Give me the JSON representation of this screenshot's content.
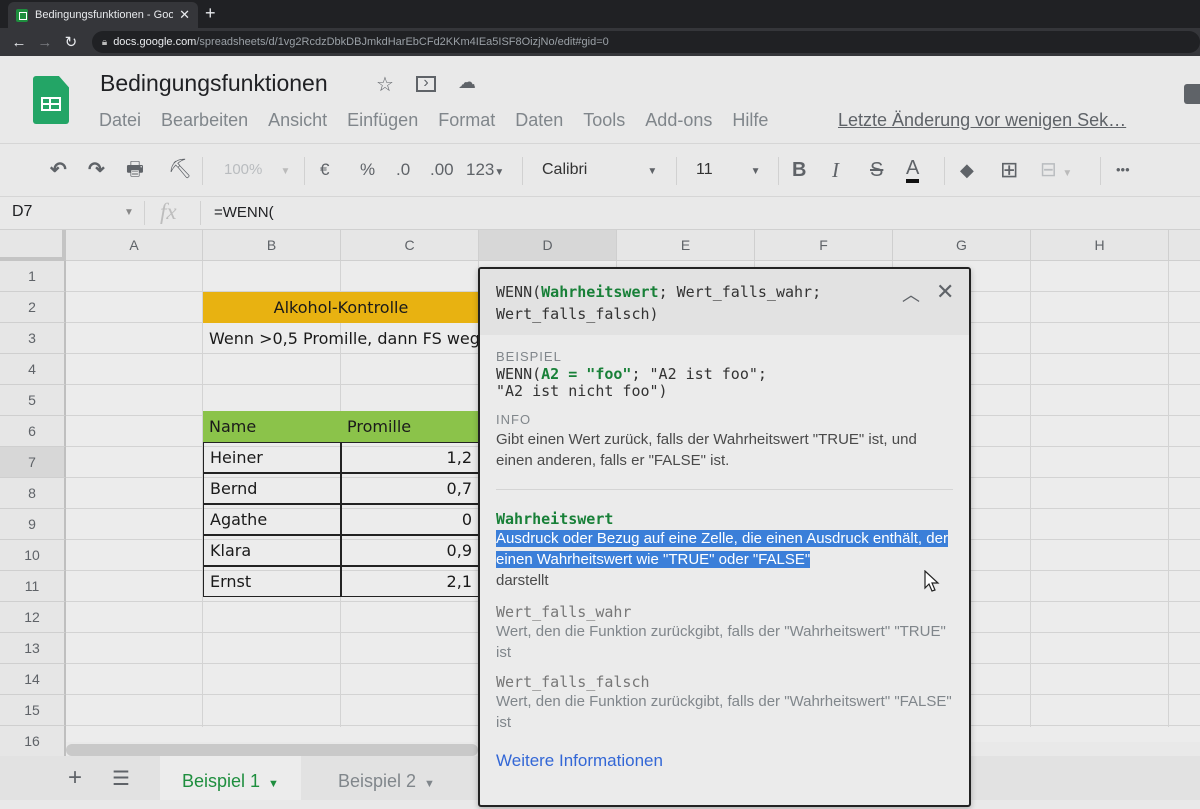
{
  "browser": {
    "tab_title": "Bedingungsfunktionen - Google",
    "url_host": "docs.google.com",
    "url_path": "/spreadsheets/d/1vg2RcdzDbkDBJmkdHarEbCFd2KKm4IEa5ISF8OizjNo/edit#gid=0"
  },
  "header": {
    "title": "Bedingungsfunktionen",
    "menu": [
      "Datei",
      "Bearbeiten",
      "Ansicht",
      "Einfügen",
      "Format",
      "Daten",
      "Tools",
      "Add-ons",
      "Hilfe"
    ],
    "last_edit": "Letzte Änderung vor wenigen Sek…"
  },
  "toolbar": {
    "zoom": "100%",
    "currency": "€",
    "percent": "%",
    "decimal_decrease": ".0",
    "decimal_increase": ".00",
    "number_format": "123",
    "font": "Calibri",
    "font_size": "11",
    "bold": "B",
    "italic": "I",
    "strike": "S",
    "text_color": "A",
    "more": "•••"
  },
  "formula_bar": {
    "cell_ref": "D7",
    "fx": "fx",
    "formula": "=WENN("
  },
  "grid": {
    "columns": [
      "A",
      "B",
      "C",
      "D",
      "E",
      "F",
      "G",
      "H"
    ],
    "selected_column": "D",
    "rows": [
      "1",
      "2",
      "3",
      "4",
      "5",
      "6",
      "7",
      "8",
      "9",
      "10",
      "11",
      "12",
      "13",
      "14",
      "15",
      "16"
    ],
    "selected_row": "7",
    "title_cell": "Alkohol-Kontrolle",
    "note_cell": "Wenn >0,5 Promille, dann FS weg",
    "table_headers": [
      "Name",
      "Promille"
    ],
    "table_rows": [
      {
        "name": "Heiner",
        "promille": "1,2"
      },
      {
        "name": "Bernd",
        "promille": "0,7"
      },
      {
        "name": "Agathe",
        "promille": "0"
      },
      {
        "name": "Klara",
        "promille": "0,9"
      },
      {
        "name": "Ernst",
        "promille": "2,1"
      }
    ],
    "colors": {
      "title_bg": "#e8b211",
      "header_bg": "#8bc34a"
    }
  },
  "sheets": {
    "tabs": [
      {
        "label": "Beispiel 1",
        "active": true
      },
      {
        "label": "Beispiel 2",
        "active": false
      }
    ]
  },
  "help_popup": {
    "signature_fn": "WENN(",
    "signature_arg1": "Wahrheitswert",
    "signature_rest1": "; Wert_falls_wahr;",
    "signature_rest2": "Wert_falls_falsch)",
    "example_label": "BEISPIEL",
    "example_fn": "WENN(",
    "example_cond": "A2 = \"foo\"",
    "example_rest1": "; \"A2 ist foo\";",
    "example_rest2": "\"A2 ist nicht foo\")",
    "info_label": "INFO",
    "info_text": "Gibt einen Wert zurück, falls der Wahrheitswert \"TRUE\" ist, und einen anderen, falls er \"FALSE\" ist.",
    "args": [
      {
        "name": "Wahrheitswert",
        "desc_highlighted": "Ausdruck oder Bezug auf eine Zelle, die einen Ausdruck enthält, der einen Wahrheitswert wie \"TRUE\" oder \"FALSE\"",
        "desc_rest": "darstellt"
      },
      {
        "name": "Wert_falls_wahr",
        "desc": "Wert, den die Funktion zurückgibt, falls der \"Wahrheitswert\" \"TRUE\" ist"
      },
      {
        "name": "Wert_falls_falsch",
        "desc": "Wert, den die Funktion zurückgibt, falls der \"Wahrheitswert\" \"FALSE\" ist"
      }
    ],
    "more_link": "Weitere Informationen",
    "accent_color": "#188038",
    "highlight_color": "#3b7fd9"
  }
}
